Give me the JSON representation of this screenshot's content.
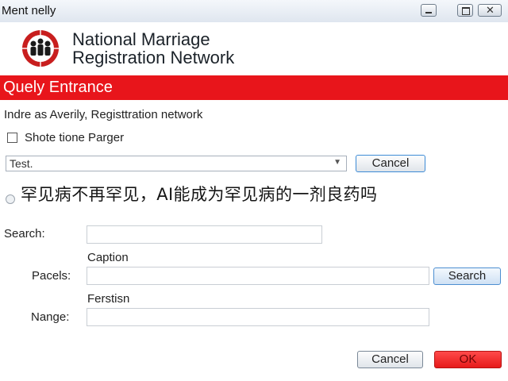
{
  "window": {
    "title": "Ment nelly",
    "controls": {
      "minimize_icon": "minimize-icon",
      "maximize_icon": "maximize-icon",
      "close_icon": "close-icon",
      "close_glyph": "✕"
    }
  },
  "header": {
    "logo_icon": "family-emblem-icon",
    "org_line1": "National Marriage",
    "org_line2": "Registration Network"
  },
  "banner": {
    "title": "Quely Entrance",
    "color": "#e8151b"
  },
  "subtitle": "Indre as Averily, Registtration network",
  "checkbox": {
    "label": "Shote tione Parger",
    "checked": false
  },
  "select": {
    "value": "Test.",
    "chevron": "▼"
  },
  "top_cancel": {
    "label": "Cancel"
  },
  "overlay": {
    "text": "罕见病不再罕见，AI能成为罕见病的一剂良药吗"
  },
  "form": {
    "search_label": "Search:",
    "search_value": "",
    "caption_label": "Caption",
    "pacels_label": "Pacels:",
    "pacels_value": "",
    "search_button": "Search",
    "ferstisn_label": "Ferstisn",
    "nange_label": "Nange:",
    "nange_value": ""
  },
  "footer": {
    "cancel_label": "Cancel",
    "ok_label": "OK",
    "ok_color": "#e61a1a"
  }
}
